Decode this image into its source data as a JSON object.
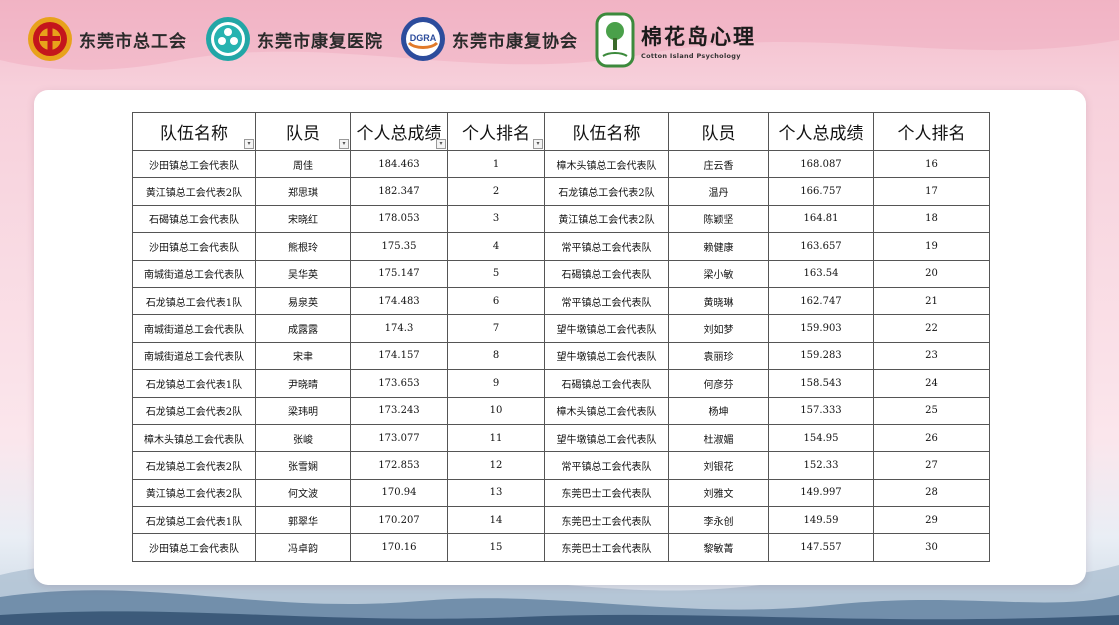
{
  "header": {
    "logos": [
      {
        "icon": "trade-union-emblem-icon",
        "label": "东莞市总工会"
      },
      {
        "icon": "rehab-hospital-logo-icon",
        "label": "东莞市康复医院"
      },
      {
        "icon": "dgra-logo-icon",
        "label": "东莞市康复协会",
        "icon_text": "DGRA"
      },
      {
        "icon": "cotton-island-logo-icon",
        "label": "棉花岛心理",
        "sublabel": "Cotton Island Psychology"
      }
    ]
  },
  "table": {
    "headers": [
      "队伍名称",
      "队员",
      "个人总成绩",
      "个人排名",
      "队伍名称",
      "队员",
      "个人总成绩",
      "个人排名"
    ],
    "filter_icon": "▾",
    "rows": [
      [
        "沙田镇总工会代表队",
        "周佳",
        "184.463",
        "1",
        "樟木头镇总工会代表队",
        "庄云香",
        "168.087",
        "16"
      ],
      [
        "黄江镇总工会代表2队",
        "郑思琪",
        "182.347",
        "2",
        "石龙镇总工会代表2队",
        "温丹",
        "166.757",
        "17"
      ],
      [
        "石碣镇总工会代表队",
        "宋晓红",
        "178.053",
        "3",
        "黄江镇总工会代表2队",
        "陈颖坚",
        "164.81",
        "18"
      ],
      [
        "沙田镇总工会代表队",
        "熊根玲",
        "175.35",
        "4",
        "常平镇总工会代表队",
        "赖健康",
        "163.657",
        "19"
      ],
      [
        "南城街道总工会代表队",
        "吴华英",
        "175.147",
        "5",
        "石碣镇总工会代表队",
        "梁小敏",
        "163.54",
        "20"
      ],
      [
        "石龙镇总工会代表1队",
        "易泉英",
        "174.483",
        "6",
        "常平镇总工会代表队",
        "黄晓琳",
        "162.747",
        "21"
      ],
      [
        "南城街道总工会代表队",
        "成露露",
        "174.3",
        "7",
        "望牛墩镇总工会代表队",
        "刘如梦",
        "159.903",
        "22"
      ],
      [
        "南城街道总工会代表队",
        "宋聿",
        "174.157",
        "8",
        "望牛墩镇总工会代表队",
        "袁丽珍",
        "159.283",
        "23"
      ],
      [
        "石龙镇总工会代表1队",
        "尹晓晴",
        "173.653",
        "9",
        "石碣镇总工会代表队",
        "何彦芬",
        "158.543",
        "24"
      ],
      [
        "石龙镇总工会代表2队",
        "梁玮明",
        "173.243",
        "10",
        "樟木头镇总工会代表队",
        "杨坤",
        "157.333",
        "25"
      ],
      [
        "樟木头镇总工会代表队",
        "张峻",
        "173.077",
        "11",
        "望牛墩镇总工会代表队",
        "杜淑媚",
        "154.95",
        "26"
      ],
      [
        "石龙镇总工会代表2队",
        "张雪娴",
        "172.853",
        "12",
        "常平镇总工会代表队",
        "刘银花",
        "152.33",
        "27"
      ],
      [
        "黄江镇总工会代表2队",
        "何文波",
        "170.94",
        "13",
        "东莞巴士工会代表队",
        "刘雅文",
        "149.997",
        "28"
      ],
      [
        "石龙镇总工会代表1队",
        "郭翠华",
        "170.207",
        "14",
        "东莞巴士工会代表队",
        "李永创",
        "149.59",
        "29"
      ],
      [
        "沙田镇总工会代表队",
        "冯卓韵",
        "170.16",
        "15",
        "东莞巴士工会代表队",
        "黎敏菁",
        "147.557",
        "30"
      ]
    ]
  }
}
